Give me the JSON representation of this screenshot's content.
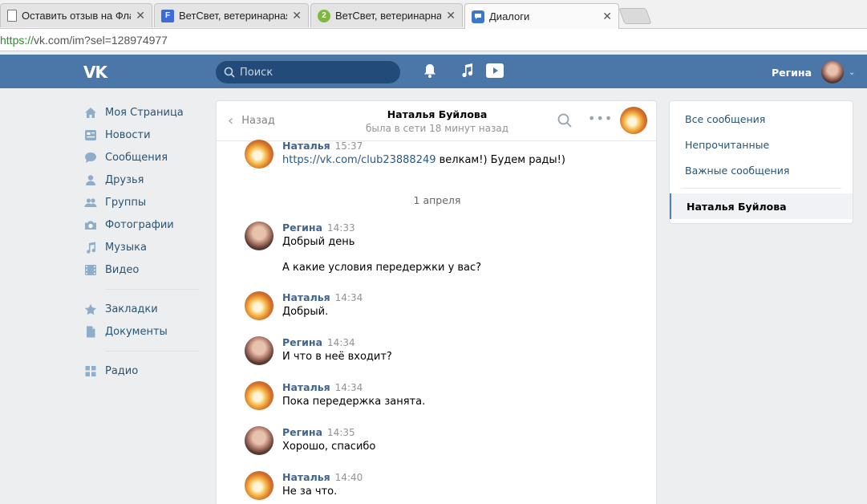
{
  "browser": {
    "tabs": [
      {
        "title": "Оставить отзыв на Флам",
        "favicon": "document-icon",
        "active": false
      },
      {
        "title": "ВетСвет, ветеринарная к",
        "favicon": "flamp-icon",
        "active": false
      },
      {
        "title": "ВетСвет, ветеринарная к",
        "favicon": "2gis-icon",
        "active": false
      },
      {
        "title": "Диалоги",
        "favicon": "vk-chat-icon",
        "active": true
      }
    ],
    "tab_close": "✕",
    "favicon_text": {
      "flamp": "F",
      "twogis": "2"
    },
    "url_scheme": "https://",
    "url_rest": "vk.com/im?sel=128974977"
  },
  "header": {
    "logo": "VK",
    "search_placeholder": "Поиск",
    "user_name": "Регина",
    "caret": "⌄",
    "colors": {
      "header_bg": "#4a76a8",
      "search_bg": "#224b7a"
    }
  },
  "left_menu": {
    "group1": [
      {
        "label": "Моя Страница",
        "icon": "home-icon"
      },
      {
        "label": "Новости",
        "icon": "news-icon"
      },
      {
        "label": "Сообщения",
        "icon": "messages-icon"
      },
      {
        "label": "Друзья",
        "icon": "friend-icon"
      },
      {
        "label": "Группы",
        "icon": "groups-icon"
      },
      {
        "label": "Фотографии",
        "icon": "camera-icon"
      },
      {
        "label": "Музыка",
        "icon": "music-icon"
      },
      {
        "label": "Видео",
        "icon": "video-icon"
      }
    ],
    "group2": [
      {
        "label": "Закладки",
        "icon": "star-icon"
      },
      {
        "label": "Документы",
        "icon": "document-icon"
      }
    ],
    "group3": [
      {
        "label": "Радио",
        "icon": "apps-grid-icon"
      }
    ]
  },
  "chat": {
    "back_label": "Назад",
    "back_chevron": "‹",
    "more": "•••",
    "peer_name": "Наталья Буйлова",
    "peer_status": "была в сети 18 минут назад",
    "first_message": {
      "author": "Наталья",
      "time": "15:37",
      "link": "https://vk.com/club23888249",
      "text": " велкам!) Будем рады!)"
    },
    "date_separator": "1 апреля",
    "messages": [
      {
        "author": "Регина",
        "time": "14:33",
        "lines": [
          "Добрый день"
        ],
        "avatar": "regina"
      },
      {
        "author": "",
        "time": "",
        "lines": [
          "А какие условия передержки у вас?"
        ],
        "avatar": ""
      },
      {
        "author": "Наталья",
        "time": "14:34",
        "lines": [
          "Добрый."
        ],
        "avatar": "natalya"
      },
      {
        "author": "Регина",
        "time": "14:34",
        "lines": [
          "И что в неё входит?"
        ],
        "avatar": "regina"
      },
      {
        "author": "Наталья",
        "time": "14:34",
        "lines": [
          "Пока передержка занята."
        ],
        "avatar": "natalya"
      },
      {
        "author": "Регина",
        "time": "14:35",
        "lines": [
          "Хорошо, спасибо"
        ],
        "avatar": "regina"
      },
      {
        "author": "Наталья",
        "time": "14:40",
        "lines": [
          "Не за что."
        ],
        "avatar": "natalya"
      }
    ]
  },
  "right_panel": {
    "items": [
      "Все сообщения",
      "Непрочитанные",
      "Важные сообщения"
    ],
    "active_dialog": "Наталья Буйлова"
  }
}
